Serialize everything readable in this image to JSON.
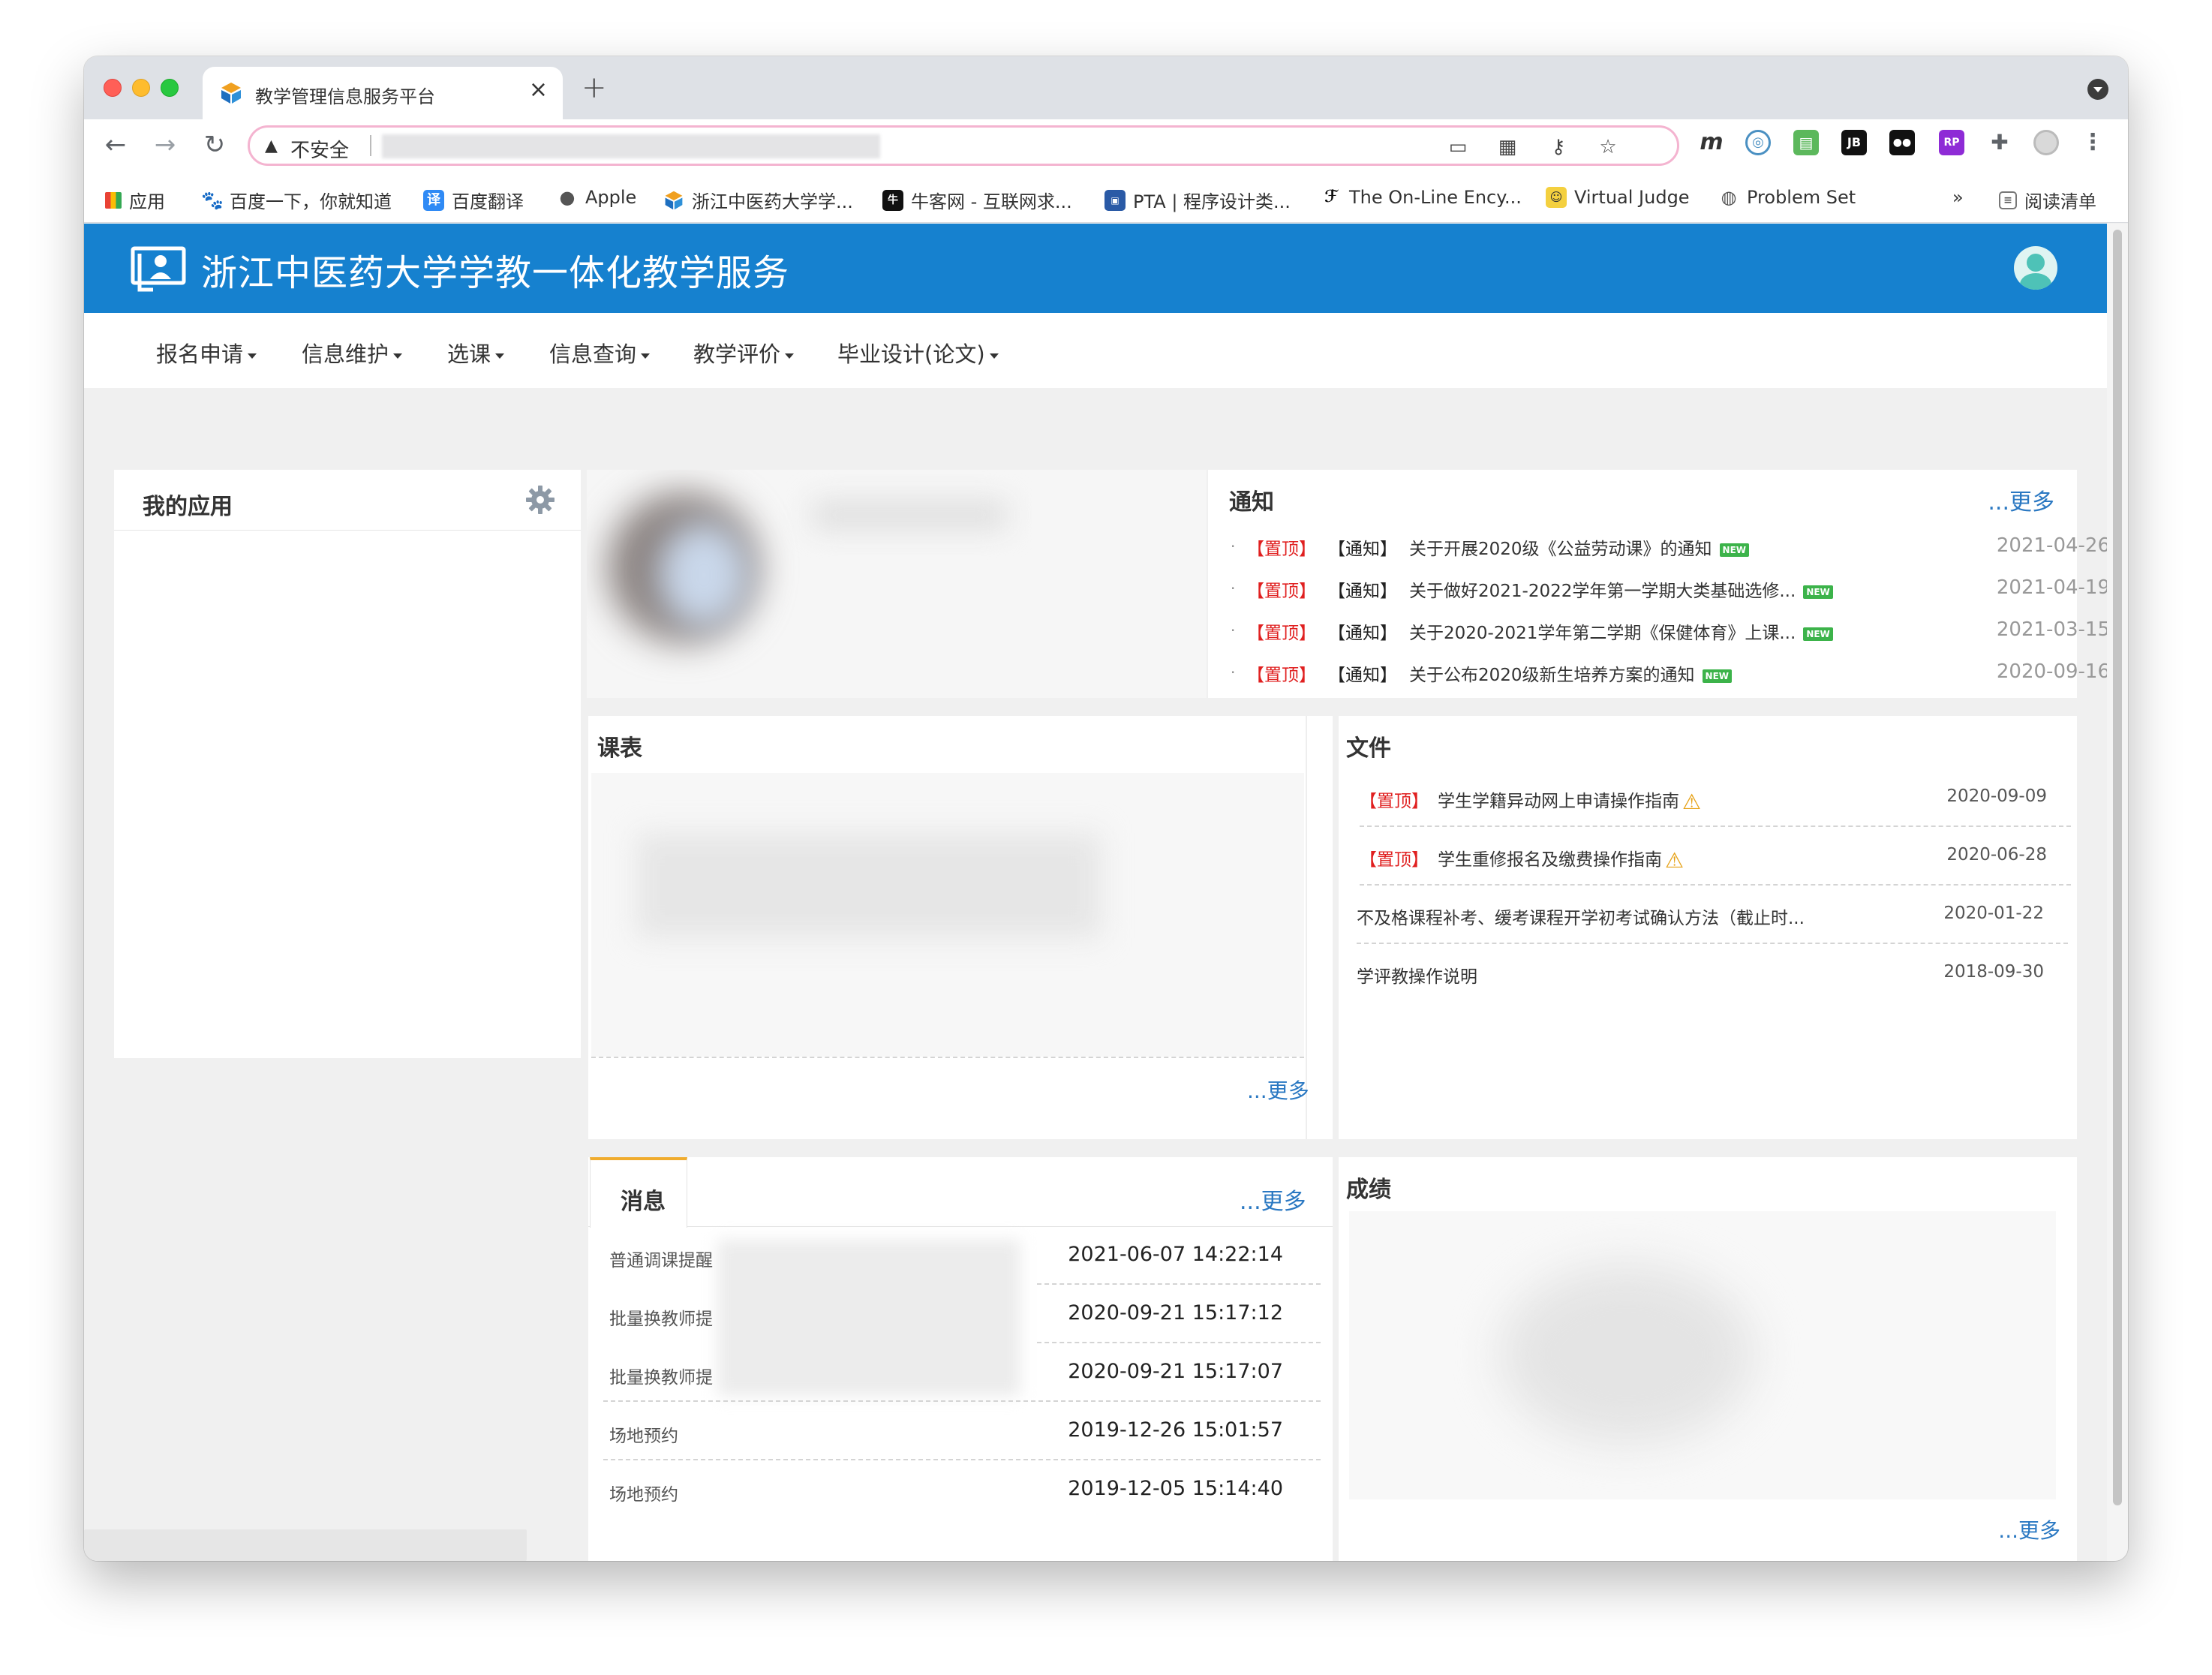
{
  "browser": {
    "tab_title": "教学管理信息服务平台",
    "tab_close": "×",
    "new_tab": "+",
    "security_label": "不安全",
    "nav_back": "←",
    "nav_forward": "→",
    "nav_reload": "↻",
    "omnibox_icons": [
      "cast-icon",
      "qr-icon",
      "key-icon",
      "star-icon"
    ],
    "extensions": [
      {
        "name": "m-extension-icon",
        "glyph": "m",
        "color": "#ffffff"
      },
      {
        "name": "compass-extension-icon",
        "glyph": "◎",
        "color": "#4a90c2"
      },
      {
        "name": "printer-extension-icon",
        "glyph": "▤",
        "color": "#5cb85c"
      },
      {
        "name": "jb-extension-icon",
        "glyph": "JB",
        "color": "#111111"
      },
      {
        "name": "tampermonkey-extension-icon",
        "glyph": "●●",
        "color": "#111111"
      },
      {
        "name": "rp-extension-icon",
        "glyph": "RP",
        "color": "#8e2bd6"
      },
      {
        "name": "puzzle-extension-icon",
        "glyph": "✚",
        "color": "#5f6368"
      }
    ],
    "bookmarks": [
      {
        "label": "应用",
        "icon": "apps-grid-icon"
      },
      {
        "label": "百度一下，你就知道",
        "icon": "baidu-icon"
      },
      {
        "label": "百度翻译",
        "icon": "baidu-translate-icon"
      },
      {
        "label": "Apple",
        "icon": "apple-icon"
      },
      {
        "label": "浙江中医药大学学...",
        "icon": "university-icon"
      },
      {
        "label": "牛客网 - 互联网求...",
        "icon": "nowcoder-icon"
      },
      {
        "label": "PTA | 程序设计类...",
        "icon": "pta-icon"
      },
      {
        "label": "The On-Line Ency...",
        "icon": "oeis-icon"
      },
      {
        "label": "Virtual Judge",
        "icon": "vjudge-icon"
      },
      {
        "label": "Problem Set",
        "icon": "globe-icon"
      }
    ],
    "bookmarks_overflow": "»",
    "reading_list": "阅读清单"
  },
  "site": {
    "title": "浙江中医药大学学教一体化教学服务",
    "menu": [
      "报名申请",
      "信息维护",
      "选课",
      "信息查询",
      "教学评价",
      "毕业设计(论文)"
    ]
  },
  "my_apps": {
    "title": "我的应用"
  },
  "notices": {
    "title": "通知",
    "more": "...更多",
    "items": [
      {
        "pin": "【置顶】",
        "tag": "【通知】",
        "title": "关于开展2020级《公益劳动课》的通知",
        "badge": "NEW",
        "date": "2021-04-26"
      },
      {
        "pin": "【置顶】",
        "tag": "【通知】",
        "title": "关于做好2021-2022学年第一学期大类基础选修...",
        "badge": "NEW",
        "date": "2021-04-19"
      },
      {
        "pin": "【置顶】",
        "tag": "【通知】",
        "title": "关于2020-2021学年第二学期《保健体育》上课...",
        "badge": "NEW",
        "date": "2021-03-15"
      },
      {
        "pin": "【置顶】",
        "tag": "【通知】",
        "title": "关于公布2020级新生培养方案的通知",
        "badge": "NEW",
        "date": "2020-09-16"
      }
    ]
  },
  "schedule": {
    "title": "课表",
    "more": "...更多"
  },
  "files": {
    "title": "文件",
    "items": [
      {
        "pin": "【置顶】",
        "title": "学生学籍异动网上申请操作指南",
        "warn": "⚠",
        "date": "2020-09-09"
      },
      {
        "pin": "【置顶】",
        "title": "学生重修报名及缴费操作指南",
        "warn": "⚠",
        "date": "2020-06-28"
      },
      {
        "pin": "",
        "title": "不及格课程补考、缓考课程开学初考试确认方法（截止时...",
        "warn": "",
        "date": "2020-01-22"
      },
      {
        "pin": "",
        "title": "学评教操作说明",
        "warn": "",
        "date": "2018-09-30"
      }
    ]
  },
  "messages": {
    "tab": "消息",
    "more": "...更多",
    "items": [
      {
        "label": "普通调课提醒",
        "date": "2021-06-07 14:22:14"
      },
      {
        "label": "批量换教师提",
        "date": "2020-09-21 15:17:12"
      },
      {
        "label": "批量换教师提",
        "date": "2020-09-21 15:17:07"
      },
      {
        "label": "场地预约",
        "date": "2019-12-26 15:01:57"
      },
      {
        "label": "场地预约",
        "date": "2019-12-05 15:14:40"
      }
    ]
  },
  "grades": {
    "title": "成绩",
    "more": "...更多"
  },
  "colors": {
    "header": "#1681cf",
    "link": "#2a78c2",
    "pin": "#e02020",
    "tab_accent": "#f0ac2e"
  }
}
